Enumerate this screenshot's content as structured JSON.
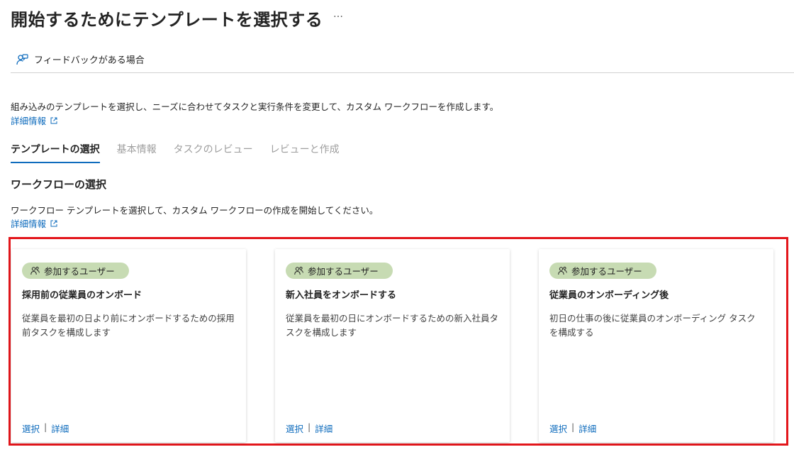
{
  "page": {
    "title": "開始するためにテンプレートを選択する",
    "more_label": "…",
    "feedback_label": "フィードバックがある場合",
    "description": "組み込みのテンプレートを選択し、ニーズに合わせてタスクと実行条件を変更して、カスタム ワークフローを作成します。",
    "learn_more": "詳細情報"
  },
  "tabs": [
    {
      "label": "テンプレートの選択",
      "active": true
    },
    {
      "label": "基本情報",
      "active": false
    },
    {
      "label": "タスクのレビュー",
      "active": false
    },
    {
      "label": "レビューと作成",
      "active": false
    }
  ],
  "section": {
    "title": "ワークフローの選択",
    "description": "ワークフロー テンプレートを選択して、カスタム ワークフローの作成を開始してください。",
    "learn_more": "詳細情報"
  },
  "cards": [
    {
      "badge": "参加するユーザー",
      "title": "採用前の従業員のオンボード",
      "description": "従業員を最初の日より前にオンボードするための採用前タスクを構成します",
      "select_label": "選択",
      "separator": "|",
      "details_label": "詳細"
    },
    {
      "badge": "参加するユーザー",
      "title": "新入社員をオンボードする",
      "description": "従業員を最初の日にオンボードするための新入社員タスクを構成します",
      "select_label": "選択",
      "separator": "|",
      "details_label": "詳細"
    },
    {
      "badge": "参加するユーザー",
      "title": "従業員のオンボーディング後",
      "description": "初日の仕事の後に従業員のオンボーディング タスクを構成する",
      "select_label": "選択",
      "separator": "|",
      "details_label": "詳細"
    }
  ],
  "colors": {
    "accent": "#0f6cbd",
    "badge_bg": "#c7dbb3",
    "highlight_border": "#e3161b"
  },
  "icons": {
    "feedback": "person-feedback-icon",
    "external_link": "open-external-icon",
    "people": "people-icon"
  }
}
